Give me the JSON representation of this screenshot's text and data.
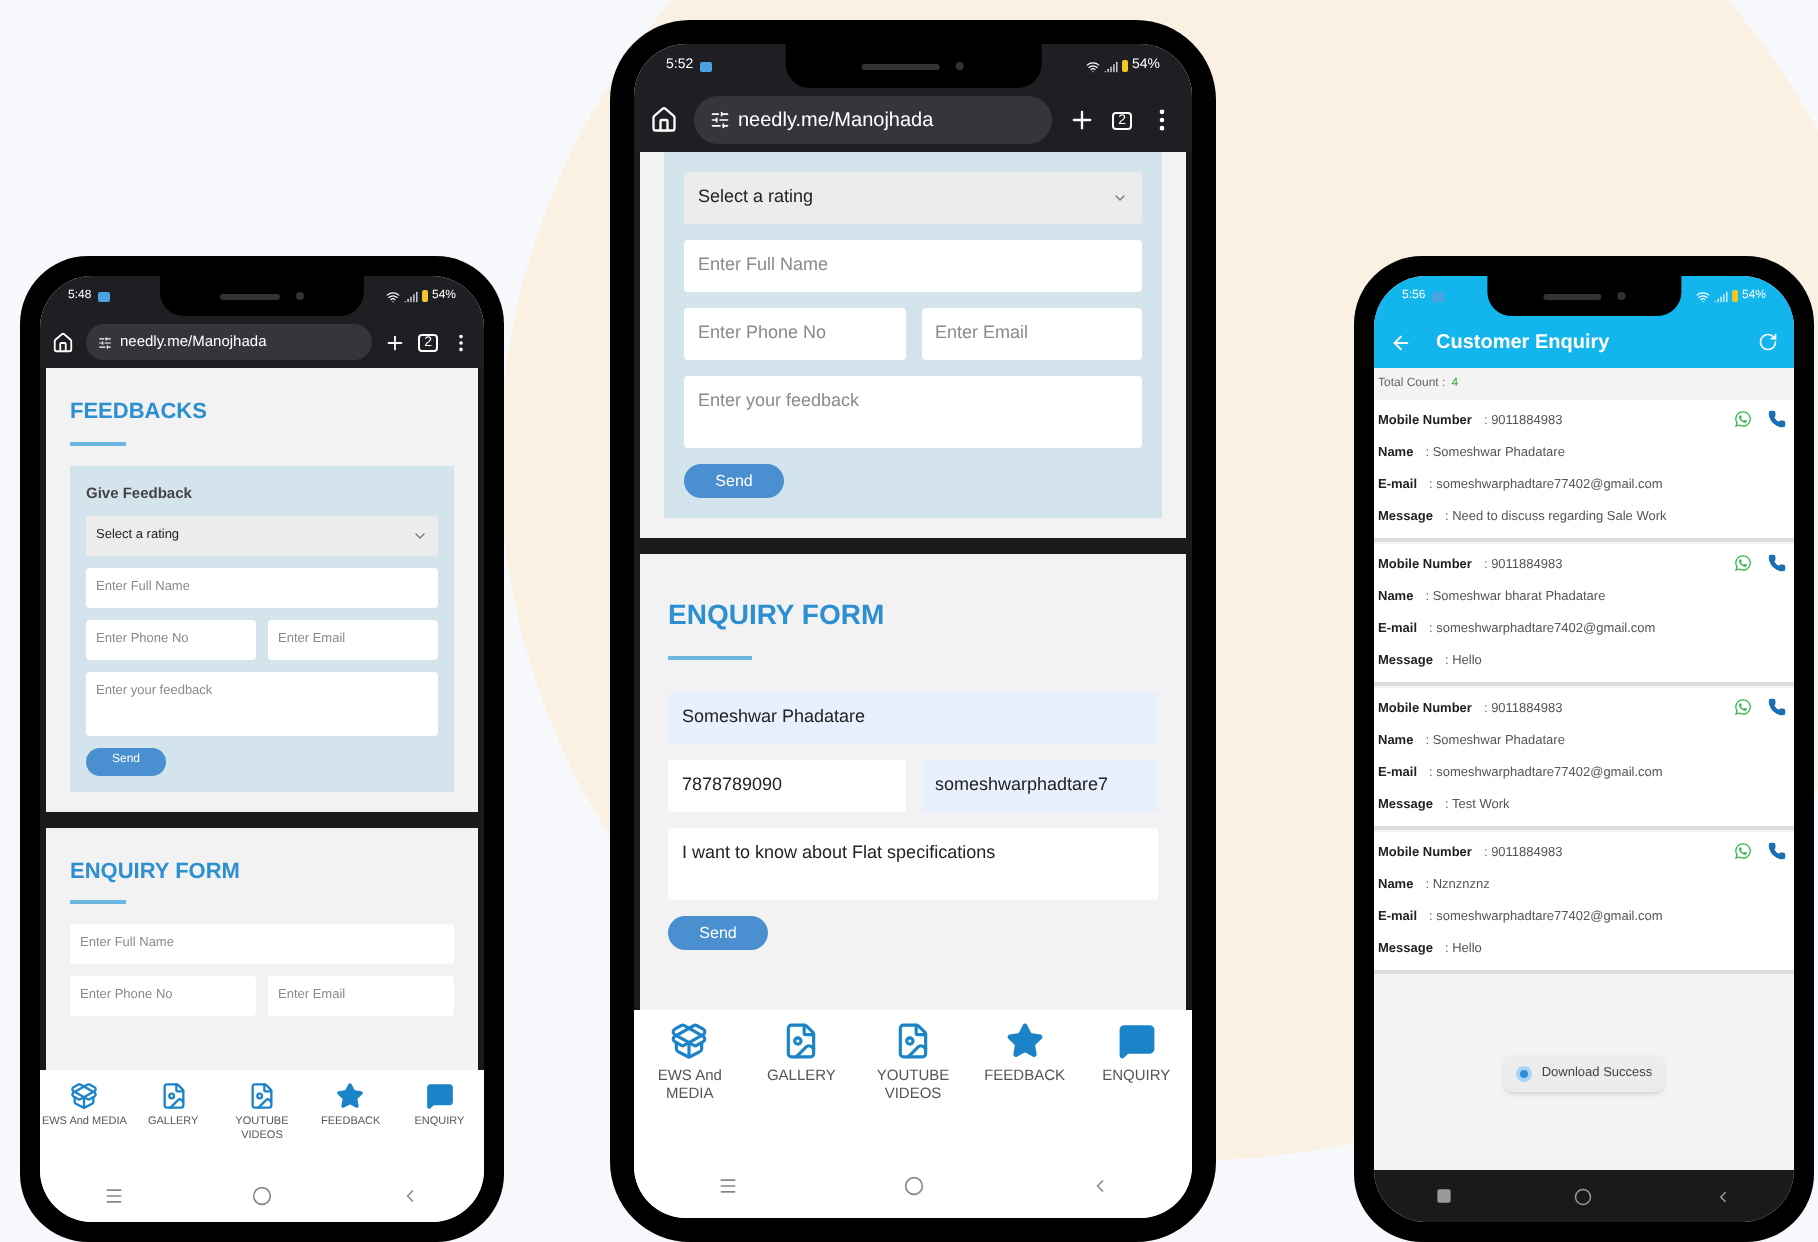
{
  "phones": [
    {
      "kind": "browser",
      "status_bar": {
        "time": "5:48",
        "battery": "54%"
      },
      "browser_bar": {
        "url": "needly.me/Manojhada",
        "tab_count": "2"
      },
      "sections": [
        {
          "heading": "FEEDBACKS",
          "panel": {
            "title": "Give Feedback",
            "fields": [
              {
                "kind": "select",
                "value": "Select a rating"
              },
              {
                "kind": "input",
                "placeholder": "Enter Full Name"
              },
              {
                "kind": "pair",
                "items": [
                  {
                    "kind": "input",
                    "placeholder": "Enter Phone No"
                  },
                  {
                    "kind": "input",
                    "placeholder": "Enter Email"
                  }
                ]
              },
              {
                "kind": "textarea",
                "placeholder": "Enter your feedback"
              }
            ],
            "button": "Send"
          }
        },
        {
          "heading": "ENQUIRY FORM",
          "fields": [
            {
              "kind": "input",
              "placeholder": "Enter Full Name"
            },
            {
              "kind": "pair",
              "items": [
                {
                  "kind": "input",
                  "placeholder": "Enter Phone No"
                },
                {
                  "kind": "input",
                  "placeholder": "Enter Email"
                }
              ]
            }
          ]
        }
      ],
      "bottom_nav": [
        {
          "label": "EWS And MEDIA"
        },
        {
          "label": "GALLERY"
        },
        {
          "label": "YOUTUBE VIDEOS"
        },
        {
          "label": "FEEDBACK"
        },
        {
          "label": "ENQUIRY"
        }
      ]
    },
    {
      "kind": "browser",
      "status_bar": {
        "time": "5:52",
        "battery": "54%"
      },
      "browser_bar": {
        "url": "needly.me/Manojhada",
        "tab_count": "2"
      },
      "sections": [
        {
          "panel": {
            "fields": [
              {
                "kind": "select",
                "value": "Select a rating"
              },
              {
                "kind": "input",
                "placeholder": "Enter Full Name"
              },
              {
                "kind": "pair",
                "items": [
                  {
                    "kind": "input",
                    "placeholder": "Enter Phone No"
                  },
                  {
                    "kind": "input",
                    "placeholder": "Enter Email"
                  }
                ]
              },
              {
                "kind": "textarea",
                "placeholder": "Enter your feedback"
              }
            ],
            "button": "Send"
          }
        },
        {
          "heading": "ENQUIRY FORM",
          "fields": [
            {
              "kind": "input",
              "value": "Someshwar Phadatare",
              "autofilled": true
            },
            {
              "kind": "pair",
              "items": [
                {
                  "kind": "input",
                  "value": "7878789090",
                  "autofilled": false
                },
                {
                  "kind": "input",
                  "value": "someshwarphadtare7",
                  "autofilled": true
                }
              ]
            },
            {
              "kind": "textarea",
              "value": "I want to know about Flat specifications",
              "autofilled": false
            }
          ],
          "button": "Send"
        }
      ],
      "bottom_nav": [
        {
          "label": "EWS And MEDIA"
        },
        {
          "label": "GALLERY"
        },
        {
          "label": "YOUTUBE VIDEOS"
        },
        {
          "label": "FEEDBACK"
        },
        {
          "label": "ENQUIRY"
        }
      ]
    },
    {
      "kind": "app",
      "status_bar": {
        "time": "5:56",
        "battery": "54%"
      },
      "app_bar": {
        "title": "Customer Enquiry"
      },
      "total": {
        "label": "Total Count :",
        "value": "4"
      },
      "records": [
        {
          "fields": [
            {
              "label": "Mobile Number",
              "value": ": 9011884983"
            },
            {
              "label": "Name",
              "value": ": Someshwar Phadatare"
            },
            {
              "label": "E-mail",
              "value": ": someshwarphadtare77402@gmail.com"
            },
            {
              "label": "Message",
              "value": ": Need to discuss regarding Sale Work"
            }
          ]
        },
        {
          "fields": [
            {
              "label": "Mobile Number",
              "value": ": 9011884983"
            },
            {
              "label": "Name",
              "value": ": Someshwar bharat Phadatare"
            },
            {
              "label": "E-mail",
              "value": ": someshwarphadtare7402@gmail.com"
            },
            {
              "label": "Message",
              "value": ": Hello"
            }
          ]
        },
        {
          "fields": [
            {
              "label": "Mobile Number",
              "value": ": 9011884983"
            },
            {
              "label": "Name",
              "value": ": Someshwar Phadatare"
            },
            {
              "label": "E-mail",
              "value": ": someshwarphadtare77402@gmail.com"
            },
            {
              "label": "Message",
              "value": ": Test Work"
            }
          ]
        },
        {
          "fields": [
            {
              "label": "Mobile Number",
              "value": ": 9011884983"
            },
            {
              "label": "Name",
              "value": ": Nznznznz"
            },
            {
              "label": "E-mail",
              "value": ": someshwarphadtare77402@gmail.com"
            },
            {
              "label": "Message",
              "value": ": Hello"
            }
          ]
        }
      ],
      "toast": "Download Success"
    }
  ]
}
